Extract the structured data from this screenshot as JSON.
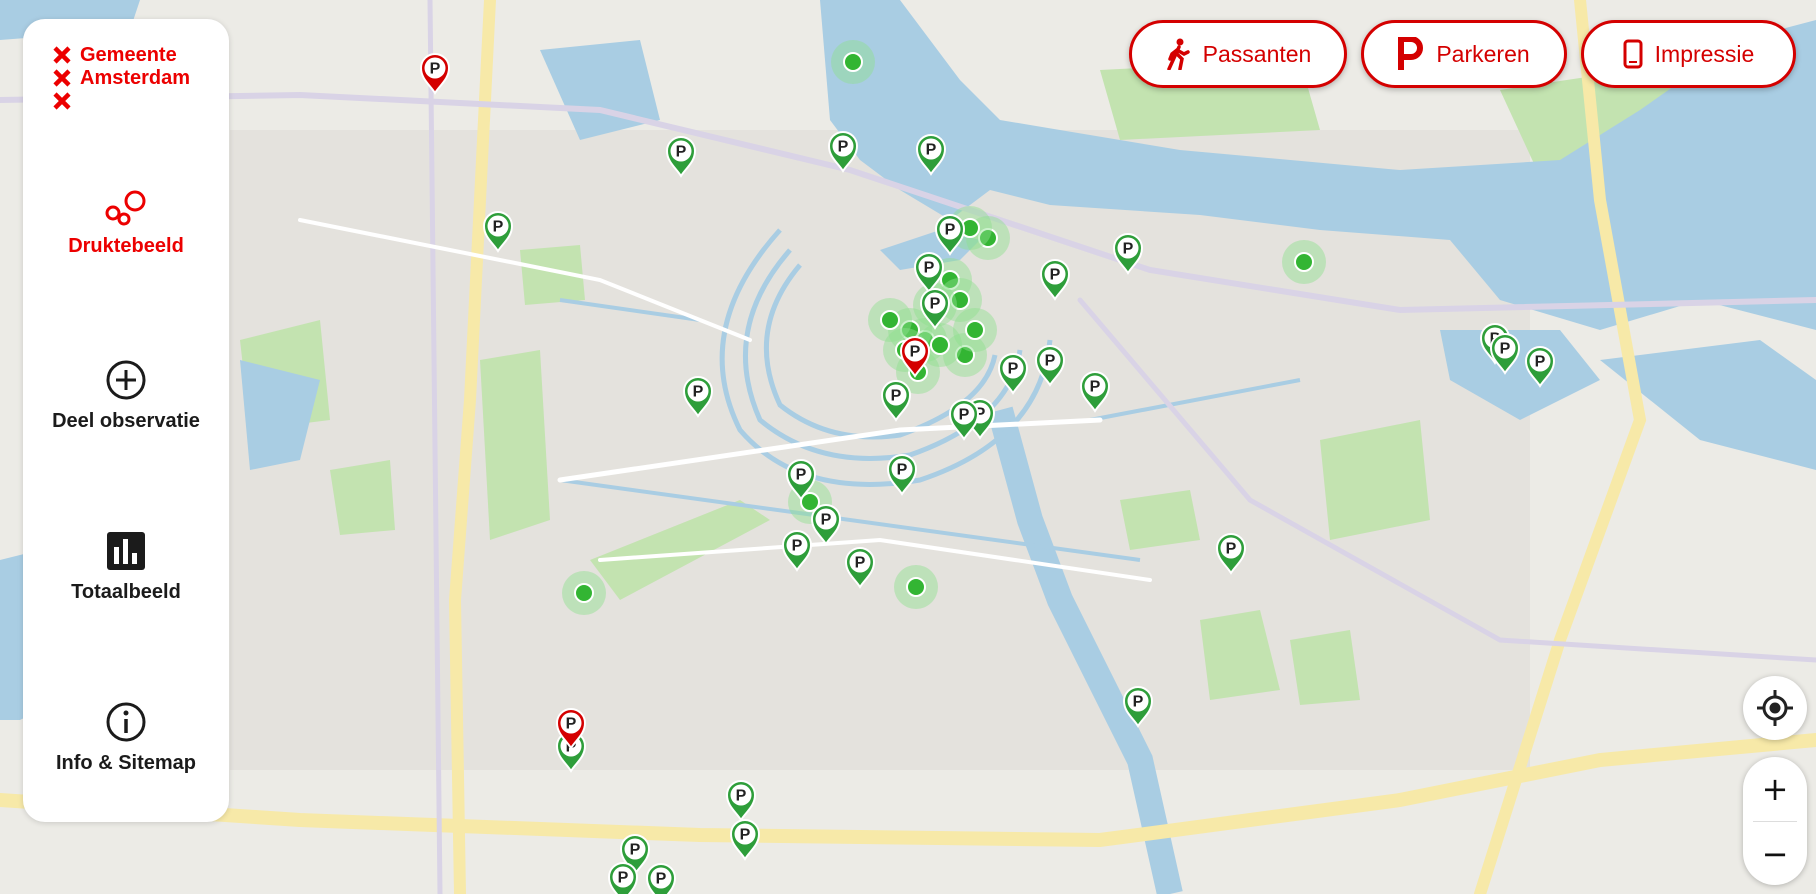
{
  "org": {
    "line1": "Gemeente",
    "line2": "Amsterdam"
  },
  "colors": {
    "brand": "#ec0000",
    "marker_green": "#2e9e3a",
    "dot_green": "#4cc94c",
    "water": "#a8cbe0",
    "park": "#b6dca1"
  },
  "nav": [
    {
      "label": "Druktebeeld",
      "icon": "crowd-circles-icon",
      "active": true
    },
    {
      "label": "Deel observatie",
      "icon": "plus-circle-icon",
      "active": false
    },
    {
      "label": "Totaalbeeld",
      "icon": "bar-chart-icon",
      "active": false
    },
    {
      "label": "Info & Sitemap",
      "icon": "info-circle-icon",
      "active": false
    }
  ],
  "top_buttons": [
    {
      "label": "Passanten",
      "icon": "pedestrian-icon"
    },
    {
      "label": "Parkeren",
      "icon": "parking-p-icon"
    },
    {
      "label": "Impressie",
      "icon": "phone-icon"
    }
  ],
  "controls": {
    "locate_icon": "locate-crosshair-icon",
    "zoom_in": "+",
    "zoom_out": "−"
  },
  "marker_letter": "P"
}
